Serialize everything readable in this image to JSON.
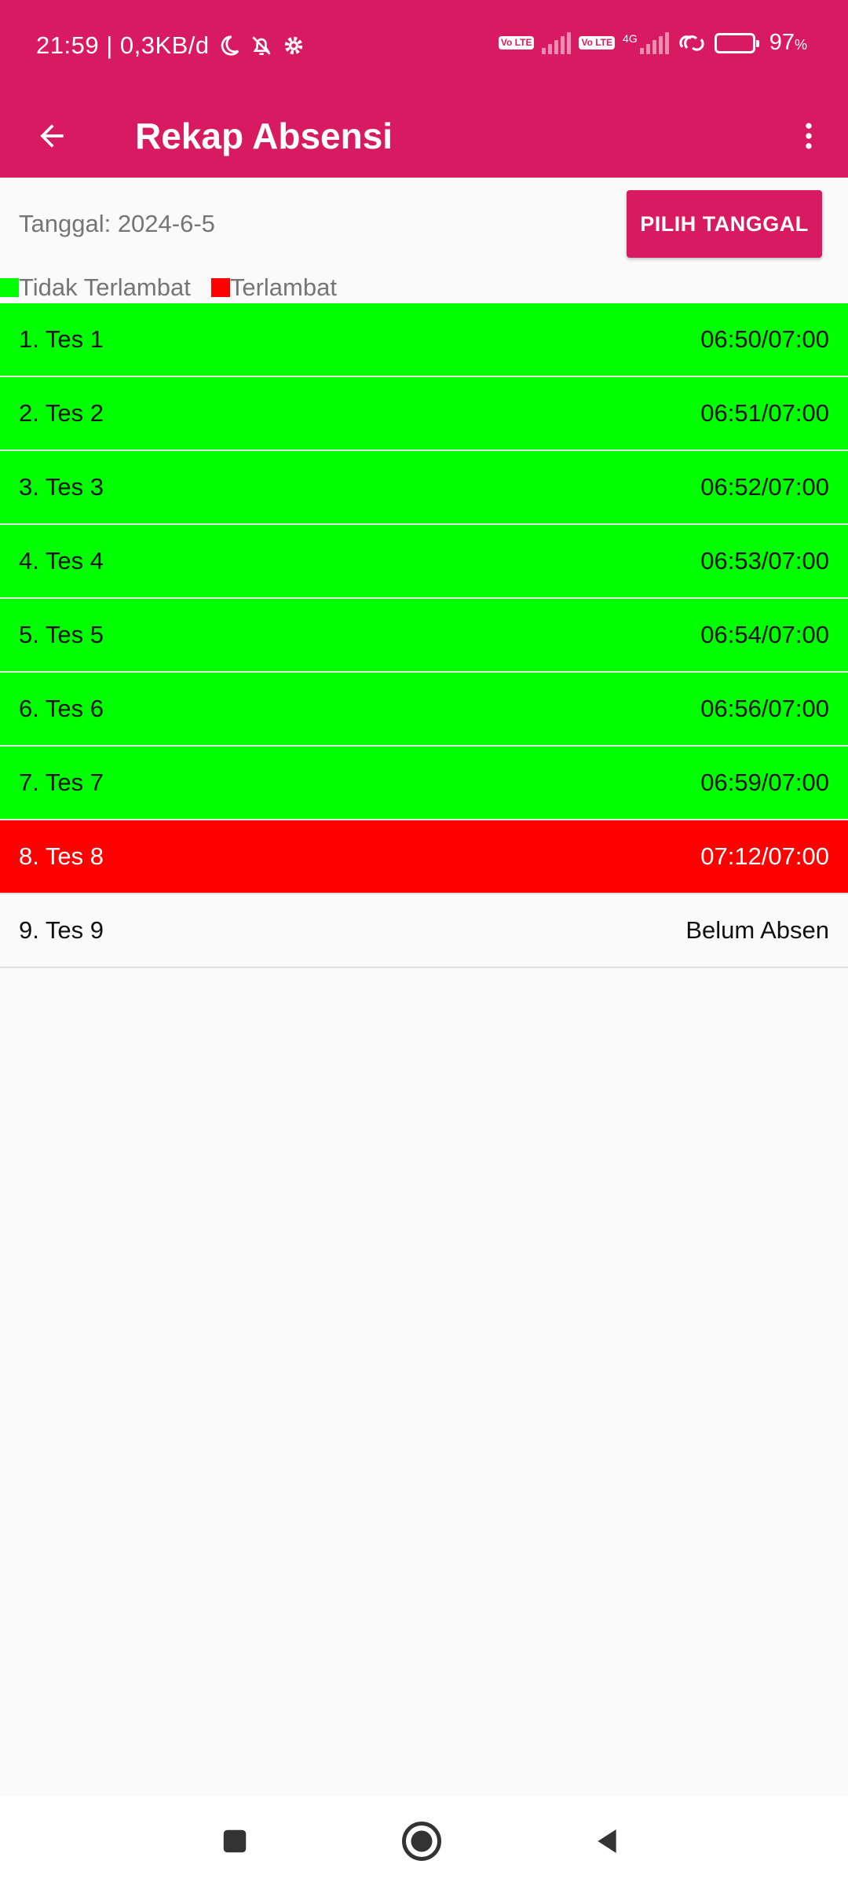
{
  "status_bar": {
    "time_speed": "21:59 | 0,3KB/d",
    "network_badge_1": "Vo LTE",
    "network_badge_2": "Vo LTE",
    "network_type": "4G",
    "battery": "97",
    "battery_unit": "%",
    "icons": [
      "moon-icon",
      "bell-off-icon",
      "gear-icon",
      "volte-icon",
      "signal-icon",
      "link-icon",
      "battery-icon"
    ]
  },
  "app_bar": {
    "title": "Rekap Absensi",
    "back_icon": "arrow-back-icon",
    "menu_icon": "more-vert-icon"
  },
  "date_section": {
    "label": "Tanggal: 2024-6-5",
    "button": "PILIH TANGGAL"
  },
  "legend": {
    "on_time": "Tidak Terlambat",
    "late": "Terlambat",
    "on_time_color": "#00ff00",
    "late_color": "#ff0000"
  },
  "rows": [
    {
      "name": "1. Tes 1",
      "time": "06:50/07:00",
      "status": "ontime"
    },
    {
      "name": "2. Tes 2",
      "time": "06:51/07:00",
      "status": "ontime"
    },
    {
      "name": "3. Tes 3",
      "time": "06:52/07:00",
      "status": "ontime"
    },
    {
      "name": "4. Tes 4",
      "time": "06:53/07:00",
      "status": "ontime"
    },
    {
      "name": "5. Tes 5",
      "time": "06:54/07:00",
      "status": "ontime"
    },
    {
      "name": "6. Tes 6",
      "time": "06:56/07:00",
      "status": "ontime"
    },
    {
      "name": "7. Tes 7",
      "time": "06:59/07:00",
      "status": "ontime"
    },
    {
      "name": "8. Tes 8",
      "time": "07:12/07:00",
      "status": "late"
    },
    {
      "name": "9. Tes 9",
      "time": "Belum Absen",
      "status": "absent"
    }
  ],
  "colors": {
    "primary": "#D81B60",
    "background": "#fafafa"
  },
  "nav_bar": {
    "icons": [
      "recents-square-icon",
      "home-circle-icon",
      "back-triangle-icon"
    ]
  }
}
